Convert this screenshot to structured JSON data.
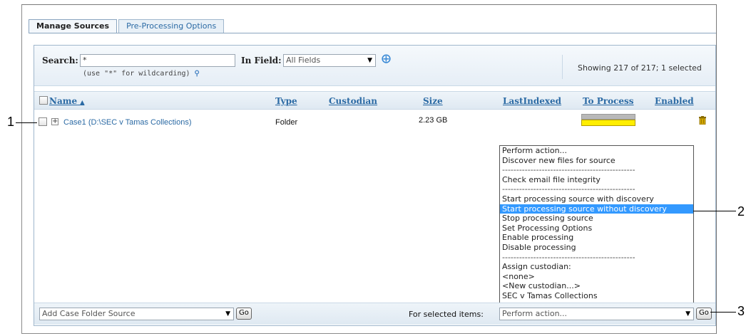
{
  "callouts": [
    "1",
    "2",
    "3"
  ],
  "tabs": [
    {
      "label": "Manage Sources",
      "active": true
    },
    {
      "label": "Pre-Processing Options",
      "active": false
    }
  ],
  "search": {
    "label": "Search:",
    "value": "*",
    "hint": "(use \"*\" for wildcarding)",
    "in_field_label": "In Field:",
    "in_field_value": "All Fields"
  },
  "status": "Showing 217 of 217; 1 selected",
  "columns": {
    "name": "Name",
    "type": "Type",
    "custodian": "Custodian",
    "size": "Size",
    "last_indexed": "LastIndexed",
    "to_process": "To Process",
    "enabled": "Enabled"
  },
  "row": {
    "name": "Case1 (D:\\SEC v Tamas Collections)",
    "type": "Folder",
    "custodian": "",
    "size": "2.23 GB"
  },
  "action_menu": [
    "Perform action...",
    "Discover new files for source",
    "-----------------------------------------------",
    "Check email file integrity",
    "-----------------------------------------------",
    "Start processing source with discovery",
    "Start processing source without discovery",
    "Stop processing source",
    "Set Processing Options",
    "Enable processing",
    "Disable processing",
    "-----------------------------------------------",
    "Assign custodian:",
    "<none>",
    "<New custodian...>",
    "SEC v Tamas Collections"
  ],
  "action_menu_selected_index": 6,
  "bottom": {
    "add_source_value": "Add Case Folder Source",
    "go_label": "Go",
    "for_selected_label": "For selected items:",
    "action_value": "Perform action...",
    "go2_label": "Go"
  },
  "colors": {
    "link": "#2b6aa4",
    "selected": "#3399ff",
    "progress_pending": "#ffee00"
  }
}
